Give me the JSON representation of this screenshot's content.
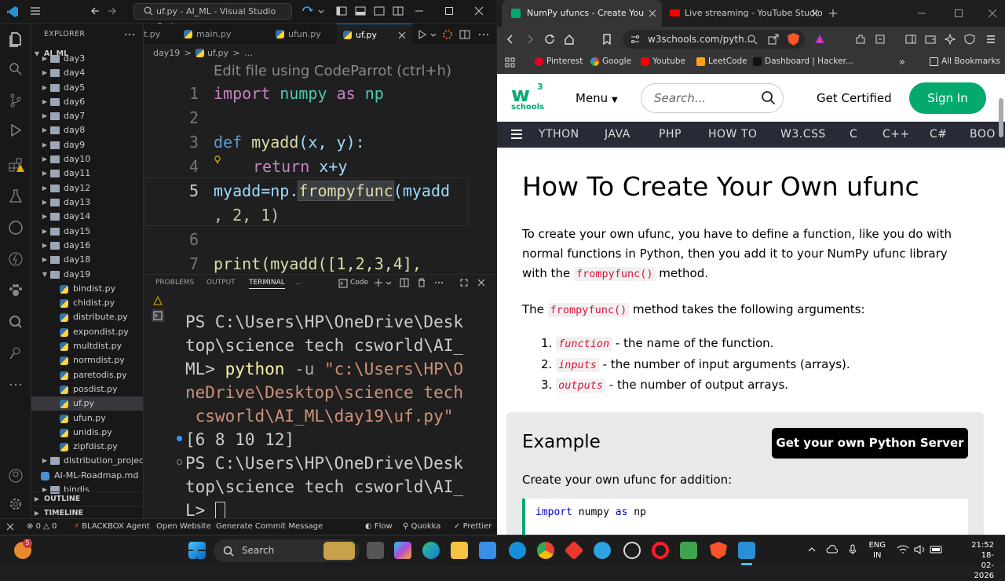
{
  "vscode": {
    "window_title": "uf.py - AI_ML - Visual Studio Code",
    "explorer": {
      "heading": "EXPLORER",
      "root": "AI_ML",
      "folders": [
        "day3",
        "day4",
        "day5",
        "day6",
        "day7",
        "day8",
        "day9",
        "day10",
        "day11",
        "day12",
        "day13",
        "day14",
        "day15",
        "day16",
        "day18",
        "day19"
      ],
      "files": [
        "bindist.py",
        "chidist.py",
        "distribute.py",
        "expondist.py",
        "multdist.py",
        "normdist.py",
        "paretodis.py",
        "posdist.py",
        "uf.py",
        "ufun.py",
        "unidis.py",
        "zipfdist.py"
      ],
      "after": [
        "distribution_project",
        "AI-ML-Roadmap.md",
        "bindis"
      ],
      "outline": "OUTLINE",
      "timeline": "TIMELINE"
    },
    "tabs": [
      "t.py",
      "main.py",
      "ufun.py",
      "uf.py"
    ],
    "breadcrumb": [
      "day19",
      ">",
      "uf.py",
      ">",
      "..."
    ],
    "hint": "Edit file using CodeParrot (ctrl+h)",
    "line_numbers": [
      "1",
      "2",
      "3",
      "4",
      "5",
      "6",
      "7"
    ],
    "code": {
      "l1_kw": "import",
      "l1_mod": "numpy",
      "l1_as": "as",
      "l1_alias": "np",
      "l3_kw": "def",
      "l3_fn": "myadd",
      "l3_args": "(x, y):",
      "l4_kw": "return",
      "l4_expr": "x+y",
      "l5a": "myadd=np.",
      "l5_fn": "frompyfunc",
      "l5b": "(myadd",
      "l5c": ", 2, 1)",
      "l7": "print(myadd([1,2,3,4],"
    },
    "panel_tabs": [
      "PROBLEMS",
      "OUTPUT",
      "TERMINAL",
      "..."
    ],
    "panel_shell": "Code",
    "terminal": {
      "p1": "PS C:\\Users\\HP\\OneDrive\\Desk",
      "p2": "top\\science tech csworld\\AI_",
      "p3a": "ML> ",
      "p3b": "python",
      "p3c": " -u ",
      "p3d": "\"c:\\Users\\HP\\O",
      "p4": "neDrive\\Desktop\\science tech",
      "p5": " csworld\\AI_ML\\day19\\uf.py\"",
      "p6": "[6 8 10 12]",
      "p7": "PS C:\\Users\\HP\\OneDrive\\Desk",
      "p8": "top\\science tech csworld\\AI_",
      "p9": "L> "
    },
    "status": {
      "errors": "0",
      "warnings": "0",
      "blackbox": "BLACKBOX Agent",
      "open_website": "Open Website",
      "commit": "Generate Commit Message",
      "flow": "Flow",
      "quokka": "Quokka",
      "prettier": "Prettier"
    }
  },
  "browser": {
    "tabs": [
      "NumPy ufuncs - Create Your Ow",
      "Live streaming - YouTube Studio"
    ],
    "url": "w3schools.com/pyth...",
    "bookmarks": [
      "Pinterest",
      "Google",
      "Youtube",
      "LeetCode",
      "Dashboard | Hacker...",
      "All Bookmarks"
    ],
    "w3": {
      "logo_sup": "3",
      "logo_text": "schools",
      "menu": "Menu",
      "search_placeholder": "Search...",
      "certified": "Get Certified",
      "signin": "Sign In",
      "nav": [
        "YTHON",
        "JAVA",
        "PHP",
        "HOW TO",
        "W3.CSS",
        "C",
        "C++",
        "C#",
        "BOO"
      ],
      "title": "How To Create Your Own ufunc",
      "p1a": "To create your own ufunc, you have to define a function, like you do with normal functions in Python, then you add it to your NumPy ufunc library with the ",
      "p1code": "frompyfunc()",
      "p1b": " method.",
      "p2a": "The ",
      "p2code": "frompyfunc()",
      "p2b": " method takes the following arguments:",
      "list": [
        {
          "num": "1.",
          "code": "function",
          "text": " - the name of the function."
        },
        {
          "num": "2.",
          "code": "inputs",
          "text": " - the number of input arguments (arrays)."
        },
        {
          "num": "3.",
          "code": "outputs",
          "text": " - the number of output arrays."
        }
      ],
      "example_heading": "Example",
      "example_button": "Get your own Python Server",
      "example_text": "Create your own ufunc for addition:",
      "example_code_kw": "import",
      "example_code_mod": " numpy ",
      "example_code_as": "as",
      "example_code_alias": " np"
    }
  },
  "taskbar": {
    "search": "Search",
    "lang1": "ENG",
    "lang2": "IN",
    "time": "21:52",
    "date": "18-02-2026",
    "badge": "5"
  },
  "colors": {
    "w3_green": "#04aa6d",
    "vs_blue": "#0078d4",
    "w3_nav": "#282a35"
  }
}
